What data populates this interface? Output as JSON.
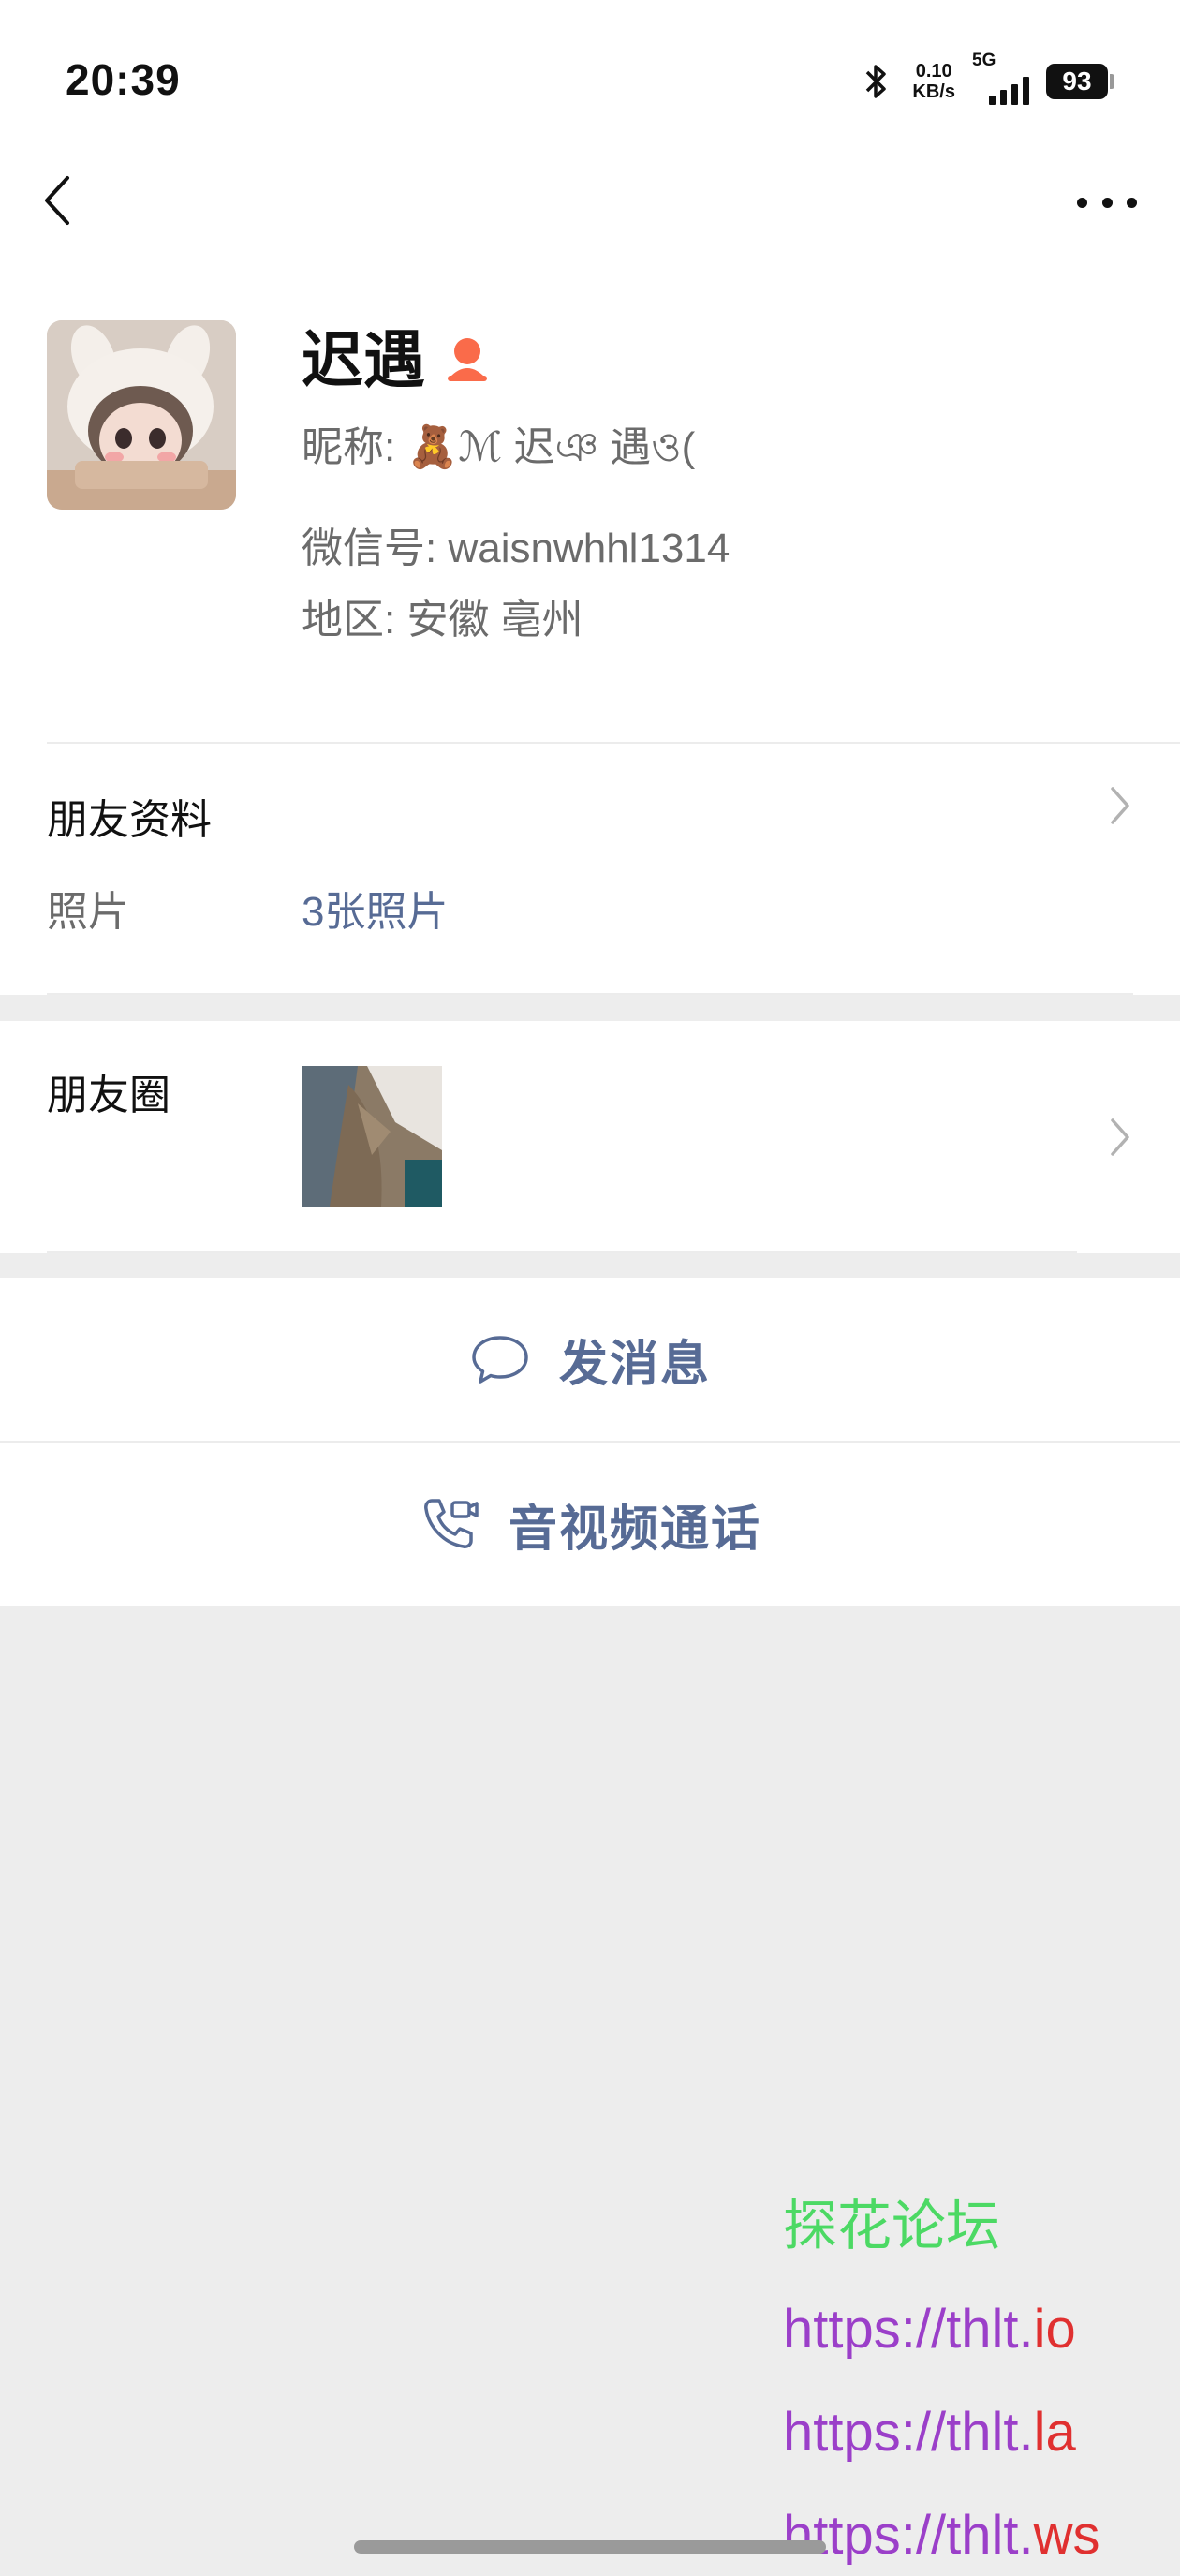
{
  "status_bar": {
    "time": "20:39",
    "net_speed_value": "0.10",
    "net_speed_unit": "KB/s",
    "network_type": "5G",
    "battery": "93"
  },
  "profile": {
    "name": "迟遇",
    "nickname_label": "昵称: ",
    "nickname_value": "🧸ℳ 迟ঞ 遇ও(",
    "wxid_label": "微信号: ",
    "wxid_value": "waisnwhhl1314",
    "region_label": "地区: ",
    "region_value": "安徽  亳州"
  },
  "friend_info": {
    "title": "朋友资料",
    "photos_label": "照片",
    "photos_value": "3张照片"
  },
  "moments": {
    "title": "朋友圈"
  },
  "actions": {
    "message_label": "发消息",
    "call_label": "音视频通话"
  },
  "watermark": {
    "forum": "探花论坛",
    "link1_base": "https://thlt.",
    "link1_tld": "io",
    "link2_base": "https://thlt.",
    "link2_tld": "la",
    "link3_base": "https://thlt.",
    "link3_tld": "ws"
  },
  "colors": {
    "link_blue": "#576b95",
    "gender_female": "#fa5151",
    "watermark_green": "#4cd964",
    "watermark_purple": "#9b3fc9",
    "watermark_red": "#e03030"
  },
  "icons": {
    "back": "chevron-left-icon",
    "more": "more-dots-icon",
    "gender": "female-icon",
    "chevron": "chevron-right-icon",
    "message": "chat-bubble-icon",
    "call": "phone-video-icon",
    "bluetooth": "bluetooth-icon"
  }
}
